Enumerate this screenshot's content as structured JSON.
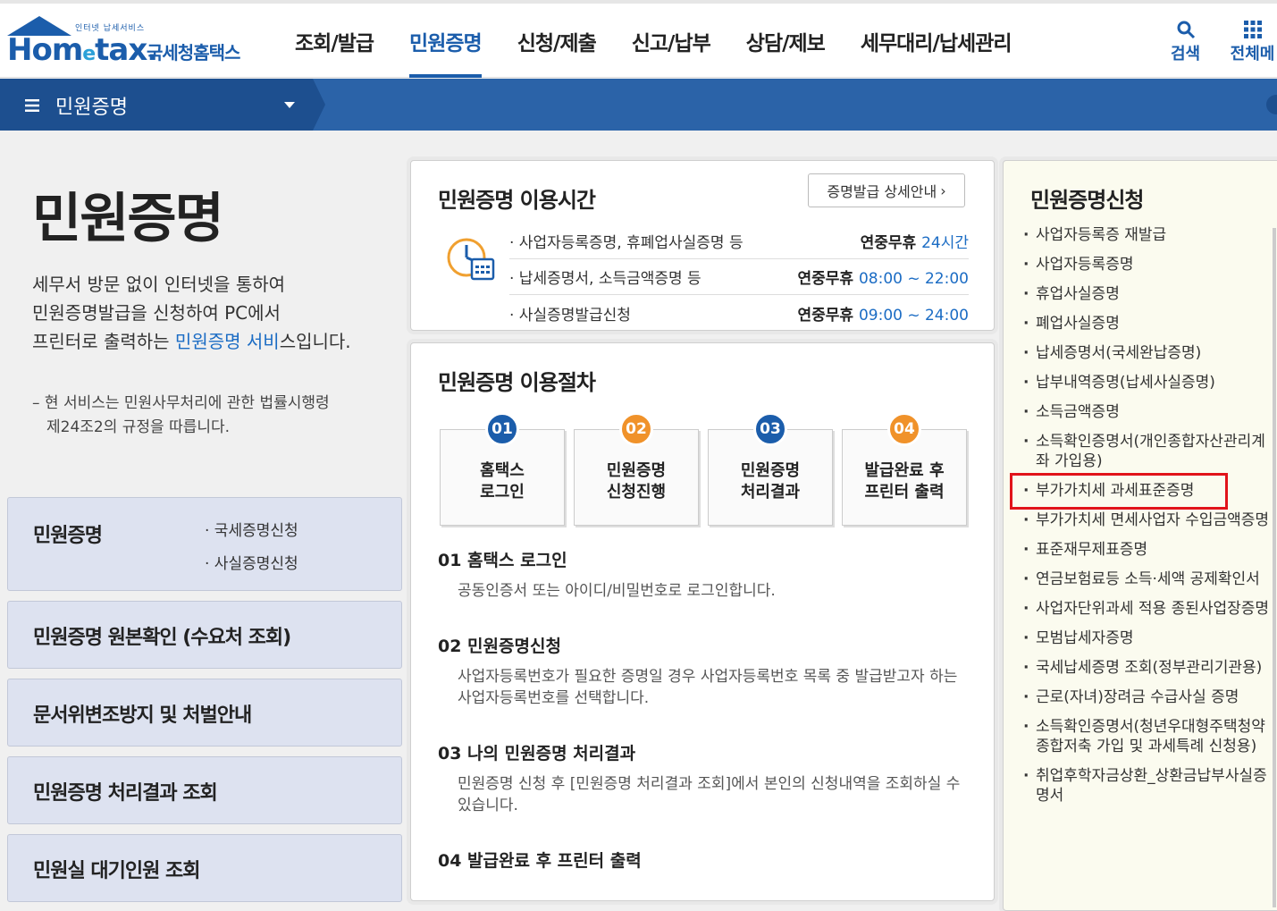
{
  "header": {
    "logo_small": "인터넷 납세서비스",
    "logo_word_1": "Hom",
    "logo_word_e": "e",
    "logo_word_2": "tax.",
    "logo_kor": "국세청홈택스",
    "nav": [
      "조회/발급",
      "민원증명",
      "신청/제출",
      "신고/납부",
      "상담/제보",
      "세무대리/납세관리"
    ],
    "active_nav": "민원증명",
    "search_label": "검색",
    "all_menu_label": "전체메"
  },
  "subbar": {
    "menu_label": "민원증명"
  },
  "left": {
    "title": "민원증명",
    "desc_1": "세무서 방문 없이 인터넷을 통하여",
    "desc_2": "민원증명발급을 신청하여 PC에서",
    "desc_3a": "프린터로 출력하는 ",
    "desc_3b": "민원증명 서비",
    "desc_3c": "스입니다.",
    "note_1": "– 현 서비스는 민원사무처리에 관한 법률시행령",
    "note_2": "제24조2의 규정을 따릅니다.",
    "boxes": [
      {
        "title": "민원증명",
        "subs": [
          "· 국세증명신청",
          "· 사실증명신청"
        ]
      },
      {
        "title": "민원증명 원본확인 (수요처 조회)"
      },
      {
        "title": "문서위변조방지 및 처벌안내"
      },
      {
        "title": "민원증명 처리결과 조회"
      },
      {
        "title": "민원실 대기인원 조회"
      }
    ]
  },
  "hours": {
    "title": "민원증명 이용시간",
    "guide_button": "증명발급 상세안내",
    "rows": [
      {
        "label": "· 사업자등록증명, 휴폐업사실증명 등",
        "pre": "연중무휴 ",
        "time": "24시간"
      },
      {
        "label": "· 납세증명서, 소득금액증명 등",
        "pre": "연중무휴 ",
        "time": "08:00 ~ 22:00"
      },
      {
        "label": "· 사실증명발급신청",
        "pre": "연중무휴 ",
        "time": "09:00 ~ 24:00"
      }
    ]
  },
  "procedure": {
    "title": "민원증명 이용절차",
    "steps": [
      {
        "num": "01",
        "line1": "홈택스",
        "line2": "로그인",
        "color": "#1b5dab"
      },
      {
        "num": "02",
        "line1": "민원증명",
        "line2": "신청진행",
        "color": "#f0922a"
      },
      {
        "num": "03",
        "line1": "민원증명",
        "line2": "처리결과",
        "color": "#1b5dab"
      },
      {
        "num": "04",
        "line1": "발급완료 후",
        "line2": "프린터 출력",
        "color": "#f0922a"
      }
    ],
    "details": [
      {
        "head": "01 홈택스 로그인",
        "body": "공동인증서 또는 아이디/비밀번호로 로그인합니다."
      },
      {
        "head": "02 민원증명신청",
        "body": "사업자등록번호가 필요한 증명일 경우 사업자등록번호 목록 중 발급받고자 하는 사업자등록번호를 선택합니다."
      },
      {
        "head": "03 나의 민원증명 처리결과",
        "body": "민원증명 신청 후 [민원증명 처리결과 조회]에서 본인의 신청내역을 조회하실 수 있습니다."
      },
      {
        "head": "04 발급완료 후 프린터 출력",
        "body": ""
      }
    ]
  },
  "apply": {
    "title": "민원증명신청",
    "items": [
      "사업자등록증 재발급",
      "사업자등록증명",
      "휴업사실증명",
      "폐업사실증명",
      "납세증명서(국세완납증명)",
      "납부내역증명(납세사실증명)",
      "소득금액증명",
      "소득확인증명서(개인종합자산관리계좌 가입용)",
      "부가가치세 과세표준증명",
      "부가가치세 면세사업자 수입금액증명",
      "표준재무제표증명",
      "연금보험료등 소득·세액 공제확인서",
      "사업자단위과세 적용 종된사업장증명",
      "모범납세자증명",
      "국세납세증명 조회(정부관리기관용)",
      "근로(자녀)장려금 수급사실 증명",
      "소득확인증명서(청년우대형주택청약종합저축 가입 및 과세특례 신청용)",
      "취업후학자금상환_상환금납부사실증명서"
    ],
    "highlighted": "부가가치세 과세표준증명",
    "highlight_color": "#e1131a"
  },
  "colors": {
    "brand": "#1b5dab",
    "subbar": "#2b63a8",
    "accent_orange": "#f0922a",
    "link": "#1b6cc4"
  }
}
